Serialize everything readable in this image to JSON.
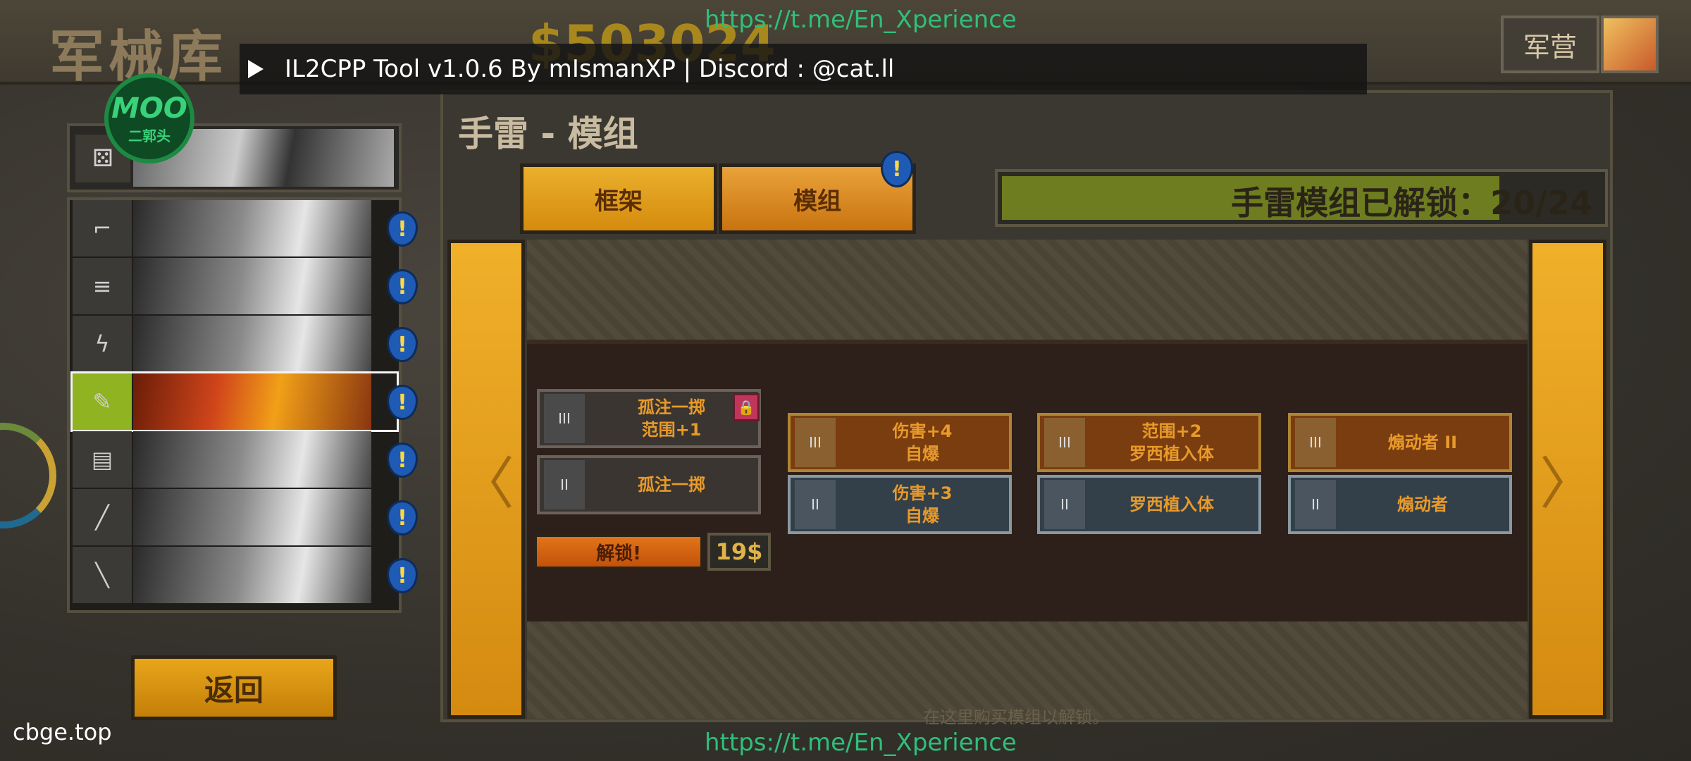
{
  "header": {
    "title": "军械库",
    "money": "$503024",
    "barracks_label": "军营"
  },
  "overlay": {
    "text": "IL2CPP Tool v1.0.6 By mIsmanXP | Discord : @cat.ll",
    "link_top": "https://t.me/En_Xperience",
    "link_bottom": "https://t.me/En_Xperience",
    "watermark": "cbge.top",
    "logo_main": "MOO",
    "logo_sub": "二郭头"
  },
  "weapons": [
    {
      "icon": "pistol-icon",
      "glyph": "⌐"
    },
    {
      "icon": "rifle-icon",
      "glyph": "≡"
    },
    {
      "icon": "lightning-icon",
      "glyph": "ϟ"
    },
    {
      "icon": "grenade-icon",
      "glyph": "✎",
      "selected": true
    },
    {
      "icon": "heavy-gun-icon",
      "glyph": "▤"
    },
    {
      "icon": "knife-icon",
      "glyph": "╱"
    },
    {
      "icon": "shotgun-icon",
      "glyph": "╲"
    }
  ],
  "back_label": "返回",
  "panel": {
    "title": "手雷 - 模组",
    "tabs": {
      "frame": "框架",
      "mods": "模组"
    },
    "progress_label": "手雷模组已解锁：20/24",
    "progress_fraction": 0.83,
    "hint": "在这里购买模组以解锁。"
  },
  "mods": {
    "col1_top": {
      "line1": "孤注一掷",
      "line2": "范围+1",
      "tier": "III"
    },
    "col1_bottom": {
      "line1": "孤注一掷",
      "line2": "",
      "tier": "II"
    },
    "col2_top": {
      "line1": "伤害+4",
      "line2": "自爆",
      "tier": "III"
    },
    "col2_bottom": {
      "line1": "伤害+3",
      "line2": "自爆",
      "tier": "II"
    },
    "col3_top": {
      "line1": "范围+2",
      "line2": "罗西植入体",
      "tier": "III"
    },
    "col3_bottom": {
      "line1": "罗西植入体",
      "line2": "",
      "tier": "II"
    },
    "col4_top": {
      "line1": "煽动者 II",
      "line2": "",
      "tier": "III"
    },
    "col4_bottom": {
      "line1": "煽动者",
      "line2": "",
      "tier": "II"
    }
  },
  "unlock": {
    "label": "解锁!",
    "price": "19$"
  },
  "colors": {
    "accent": "#e8a61a",
    "badge": "#1f5bb5",
    "progress": "#6e7d1f"
  }
}
